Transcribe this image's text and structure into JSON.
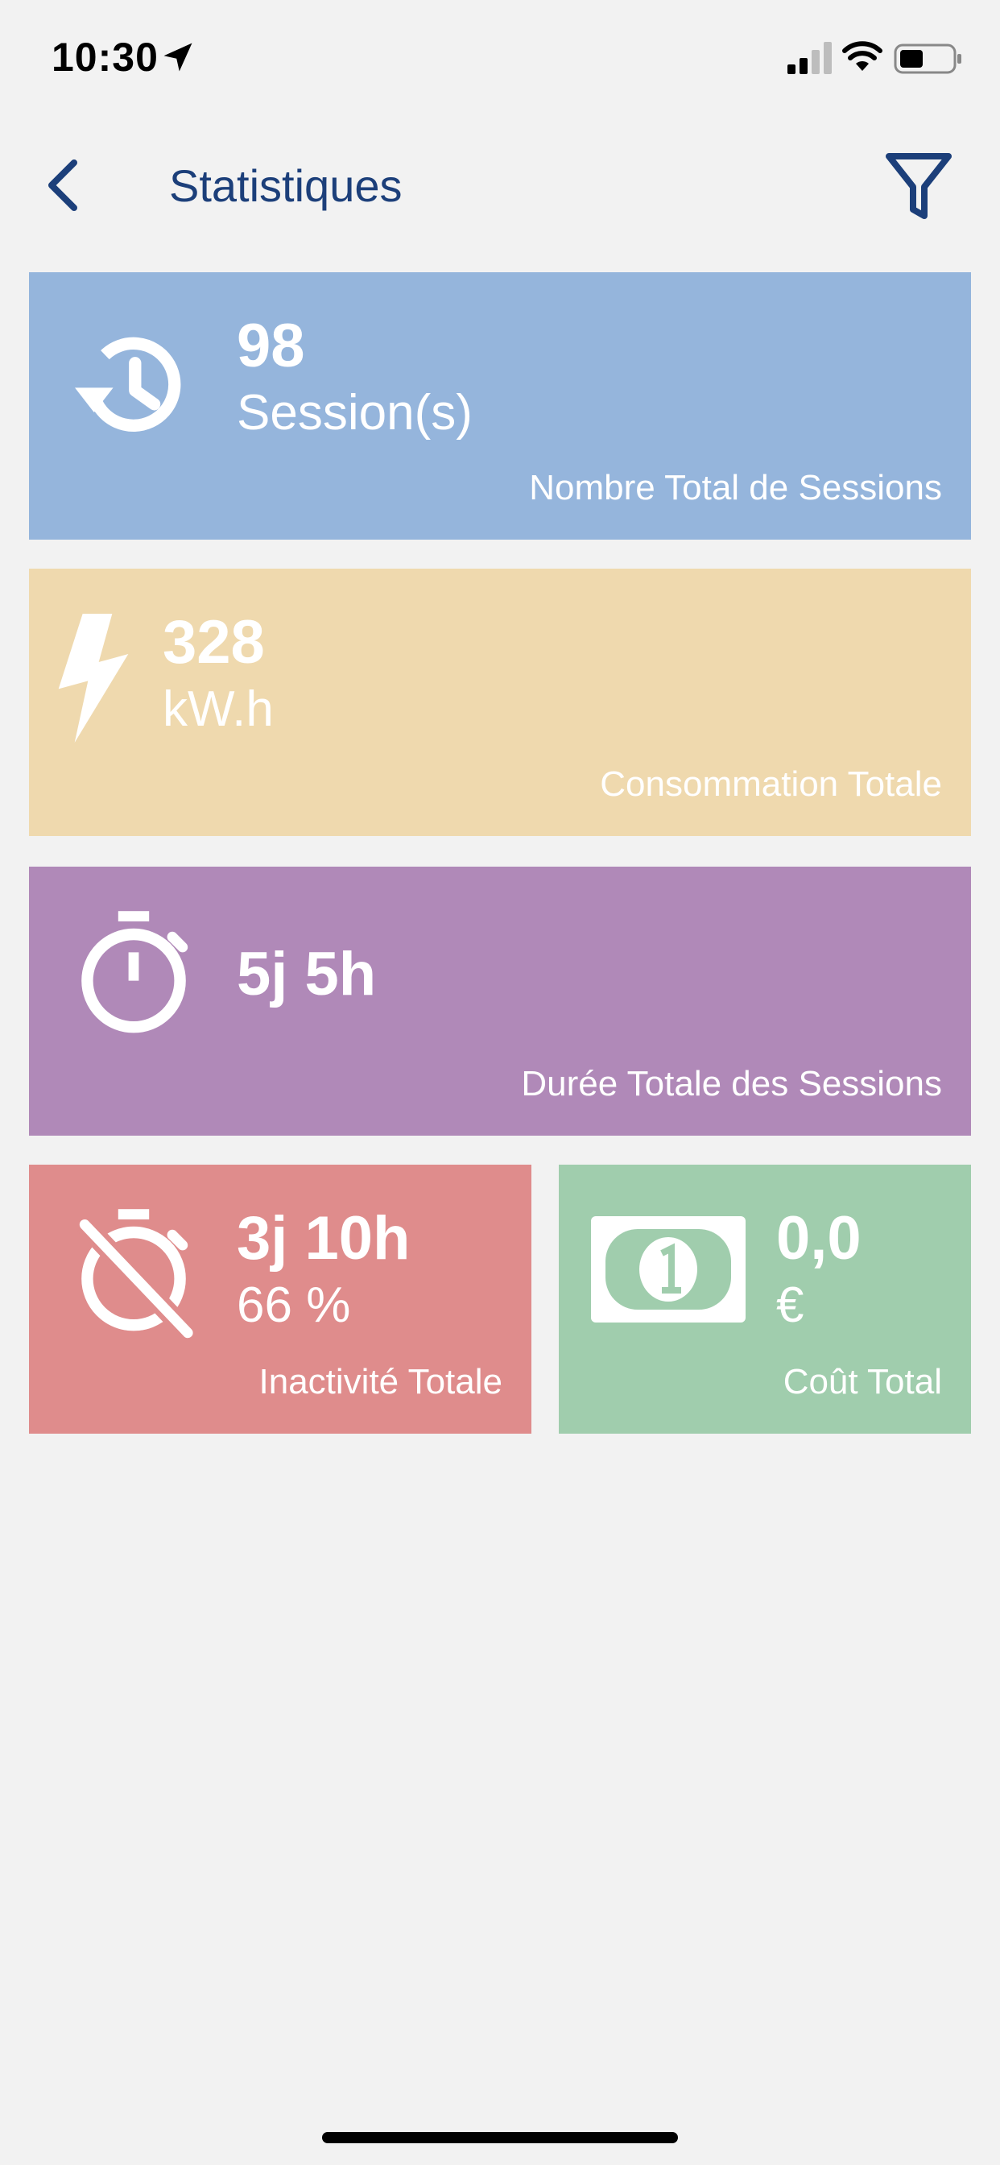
{
  "status_bar": {
    "time": "10:30"
  },
  "header": {
    "title": "Statistiques",
    "back_icon": "chevron-left-icon",
    "filter_icon": "filter-icon"
  },
  "colors": {
    "accent": "#1c3f7a",
    "sessions_card": "#95b5dc",
    "consumption_card": "#efd9ae",
    "duration_card": "#b089b8",
    "inactivity_card": "#df8c8c",
    "cost_card": "#a0cdad"
  },
  "cards": {
    "sessions": {
      "value": "98",
      "unit": "Session(s)",
      "label": "Nombre Total de Sessions",
      "icon": "history-icon"
    },
    "consumption": {
      "value": "328",
      "unit": "kW.h",
      "label": "Consommation Totale",
      "icon": "lightning-icon"
    },
    "duration": {
      "value": "5j 5h",
      "label": "Durée Totale des Sessions",
      "icon": "stopwatch-icon"
    },
    "inactivity": {
      "value": "3j 10h",
      "unit": "66 %",
      "label": "Inactivité Totale",
      "icon": "stopwatch-off-icon"
    },
    "cost": {
      "value": "0,0",
      "unit": "€",
      "label": "Coût Total",
      "icon": "banknote-icon"
    }
  }
}
